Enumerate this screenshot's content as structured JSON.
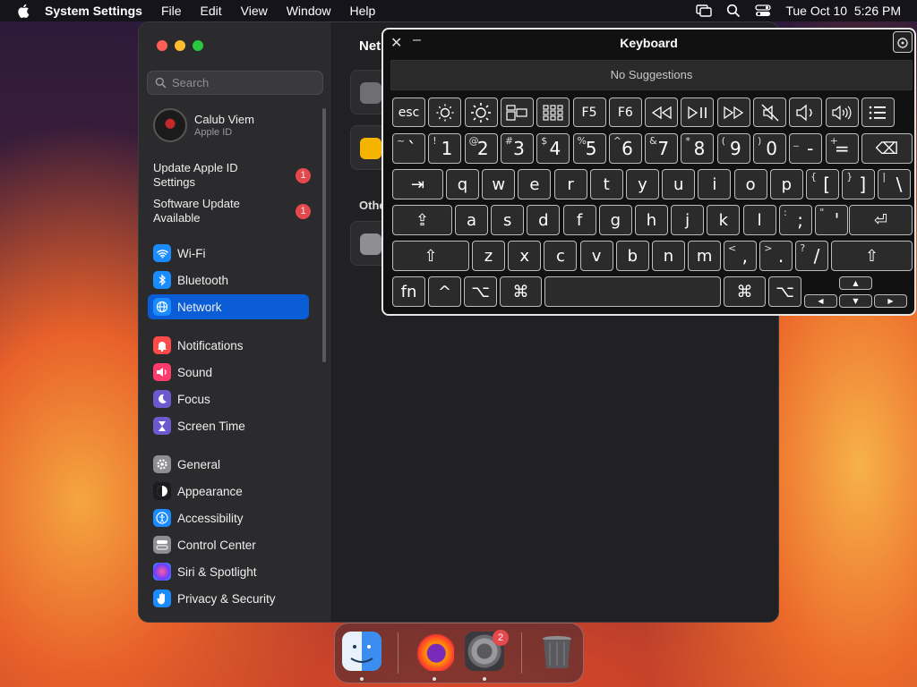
{
  "menubar": {
    "app_name": "System Settings",
    "menus": [
      "File",
      "Edit",
      "View",
      "Window",
      "Help"
    ],
    "datetime": "Tue Oct 10  5:26 PM"
  },
  "settings": {
    "search_placeholder": "Search",
    "profile": {
      "name": "Calub Viem",
      "subtitle": "Apple ID"
    },
    "updates": [
      {
        "label": "Update Apple ID Settings",
        "count": "1"
      },
      {
        "label": "Software Update Available",
        "count": "1"
      }
    ],
    "nav": [
      {
        "label": "Wi-Fi",
        "color": "#1a8cff",
        "icon": "wifi-icon"
      },
      {
        "label": "Bluetooth",
        "color": "#1a8cff",
        "icon": "bluetooth-icon"
      },
      {
        "label": "Network",
        "color": "#1a8cff",
        "icon": "globe-icon",
        "selected": true
      },
      {
        "label": "Notifications",
        "color": "#ff4a4a",
        "icon": "bell-icon"
      },
      {
        "label": "Sound",
        "color": "#ff3b6b",
        "icon": "speaker-icon"
      },
      {
        "label": "Focus",
        "color": "#6a5acd",
        "icon": "moon-icon"
      },
      {
        "label": "Screen Time",
        "color": "#6a5acd",
        "icon": "hourglass-icon"
      },
      {
        "label": "General",
        "color": "#8e8e93",
        "icon": "gear-icon"
      },
      {
        "label": "Appearance",
        "color": "#1c1c1e",
        "icon": "appearance-icon"
      },
      {
        "label": "Accessibility",
        "color": "#1a8cff",
        "icon": "accessibility-icon"
      },
      {
        "label": "Control Center",
        "color": "#8e8e93",
        "icon": "toggles-icon"
      },
      {
        "label": "Siri & Spotlight",
        "color": "#b44ce8",
        "icon": "siri-icon"
      },
      {
        "label": "Privacy & Security",
        "color": "#1a8cff",
        "icon": "hand-icon"
      }
    ],
    "content": {
      "title": "Net",
      "other_section": "Othe"
    }
  },
  "keyboard": {
    "title": "Keyboard",
    "suggestions": "No Suggestions",
    "function_row": [
      "esc",
      "brightness-down-icon",
      "brightness-up-icon",
      "mission-control-icon",
      "launchpad-icon",
      "F5",
      "F6",
      "rewind-icon",
      "play-pause-icon",
      "fast-forward-icon",
      "mute-icon",
      "volume-down-icon",
      "volume-up-icon",
      "menu-list-icon"
    ],
    "number_row": [
      {
        "s": "~",
        "m": "`"
      },
      {
        "s": "!",
        "m": "1"
      },
      {
        "s": "@",
        "m": "2"
      },
      {
        "s": "#",
        "m": "3"
      },
      {
        "s": "$",
        "m": "4"
      },
      {
        "s": "%",
        "m": "5"
      },
      {
        "s": "^",
        "m": "6"
      },
      {
        "s": "&",
        "m": "7"
      },
      {
        "s": "*",
        "m": "8"
      },
      {
        "s": "(",
        "m": "9"
      },
      {
        "s": ")",
        "m": "0"
      },
      {
        "s": "_",
        "m": "-"
      },
      {
        "s": "+",
        "m": "="
      }
    ],
    "qwerty_row": [
      "q",
      "w",
      "e",
      "r",
      "t",
      "y",
      "u",
      "i",
      "o",
      "p"
    ],
    "qwerty_extra": [
      {
        "s": "{",
        "m": "["
      },
      {
        "s": "}",
        "m": "]"
      },
      {
        "s": "|",
        "m": "\\"
      }
    ],
    "home_row": [
      "a",
      "s",
      "d",
      "f",
      "g",
      "h",
      "j",
      "k",
      "l"
    ],
    "home_extra": [
      {
        "s": ":",
        "m": ";"
      },
      {
        "s": "\"",
        "m": "'"
      }
    ],
    "bottom_row": [
      "z",
      "x",
      "c",
      "v",
      "b",
      "n",
      "m"
    ],
    "bottom_extra": [
      {
        "s": "<",
        "m": ","
      },
      {
        "s": ">",
        "m": "."
      },
      {
        "s": "?",
        "m": "/"
      }
    ],
    "modifiers": {
      "fn": "fn",
      "control": "^",
      "option": "⌥",
      "command": "⌘",
      "tab": "⇥",
      "caps": "⇪",
      "shift": "⇧",
      "delete": "⌫",
      "return": "⏎"
    },
    "arrows": {
      "up": "▲",
      "down": "▼",
      "left": "◀",
      "right": "▶"
    }
  },
  "dock": {
    "settings_badge": "2"
  }
}
